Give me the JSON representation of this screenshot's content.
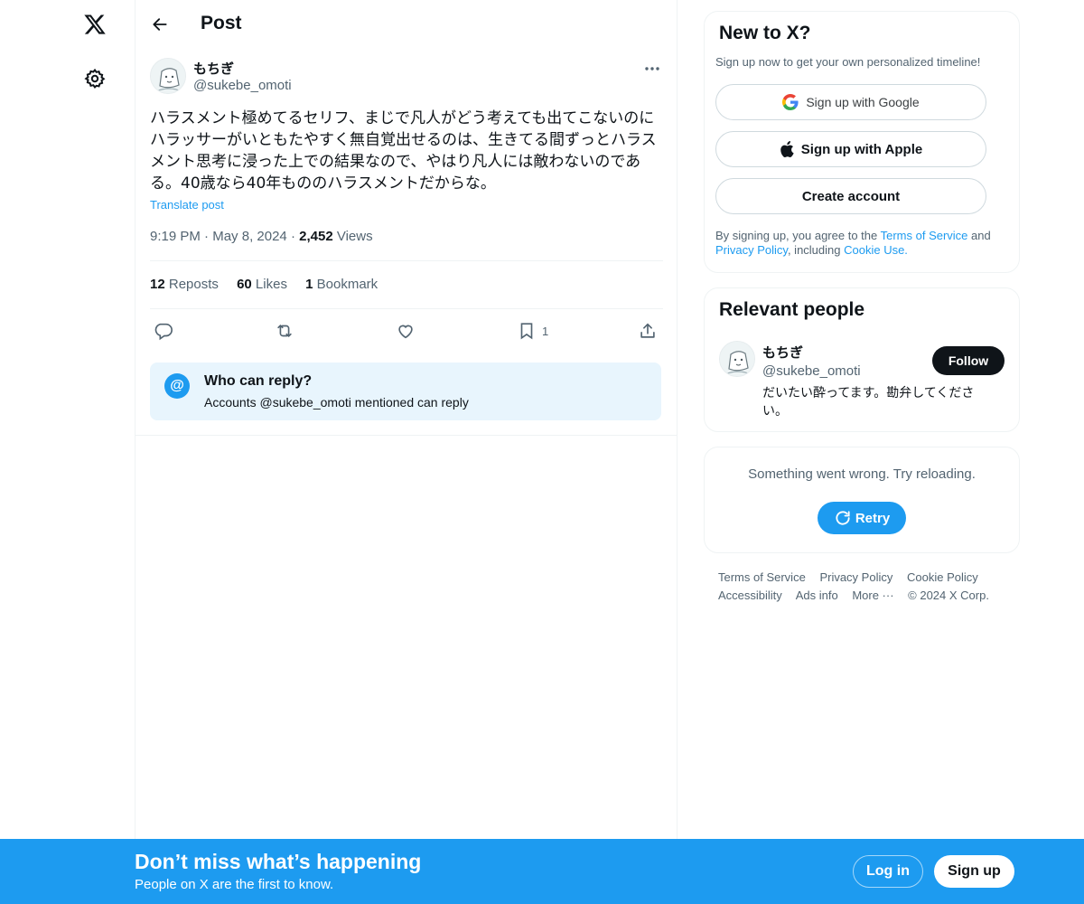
{
  "header": {
    "title": "Post"
  },
  "post": {
    "author_name": "もちぎ",
    "author_handle": "@sukebe_omoti",
    "text": "ハラスメント極めてるセリフ、まじで凡人がどう考えても出てこないのにハラッサーがいともたやすく無自覚出せるのは、生きてる間ずっとハラスメント思考に浸った上での結果なので、やはり凡人には敵わないのである。40歳なら40年もののハラスメントだからな。",
    "translate_label": "Translate post",
    "time": "9:19 PM",
    "date": "May 8, 2024",
    "views_count": "2,452",
    "views_label": "Views",
    "reposts_count": "12",
    "reposts_label": "Reposts",
    "likes_count": "60",
    "likes_label": "Likes",
    "bookmarks_count": "1",
    "bookmarks_label": "Bookmark",
    "bookmark_action_count": "1"
  },
  "who_can_reply": {
    "icon_text": "@",
    "title": "Who can reply?",
    "subtitle": "Accounts @sukebe_omoti mentioned can reply"
  },
  "signup_card": {
    "title": "New to X?",
    "subtitle": "Sign up now to get your own personalized timeline!",
    "google_label": "Sign up with Google",
    "apple_label": "Sign up with Apple",
    "create_label": "Create account",
    "legal_prefix": "By signing up, you agree to the ",
    "terms_link": "Terms of Service",
    "legal_and": " and ",
    "privacy_link": "Privacy Policy",
    "legal_including": ", including ",
    "cookie_link": "Cookie Use."
  },
  "relevant_people": {
    "title": "Relevant people",
    "name": "もちぎ",
    "handle": "@sukebe_omoti",
    "bio": "だいたい酔ってます。勘弁してください。",
    "follow_label": "Follow"
  },
  "error_card": {
    "message": "Something went wrong. Try reloading.",
    "retry_label": "Retry"
  },
  "footer": {
    "terms": "Terms of Service",
    "privacy": "Privacy Policy",
    "cookie": "Cookie Policy",
    "accessibility": "Accessibility",
    "ads": "Ads info",
    "more": "More ···",
    "copyright": "© 2024 X Corp."
  },
  "banner": {
    "title": "Don’t miss what’s happening",
    "subtitle": "People on X are the first to know.",
    "login_label": "Log in",
    "signup_label": "Sign up"
  },
  "colors": {
    "accent": "#1d9bf0",
    "text": "#0f1419",
    "muted": "#536471",
    "reply_box_bg": "#e8f5fd"
  },
  "icons": [
    "x-logo-icon",
    "gear-icon",
    "back-arrow-icon",
    "more-icon",
    "reply-icon",
    "repost-icon",
    "like-icon",
    "bookmark-icon",
    "share-icon",
    "google-icon",
    "apple-icon",
    "retry-icon"
  ]
}
